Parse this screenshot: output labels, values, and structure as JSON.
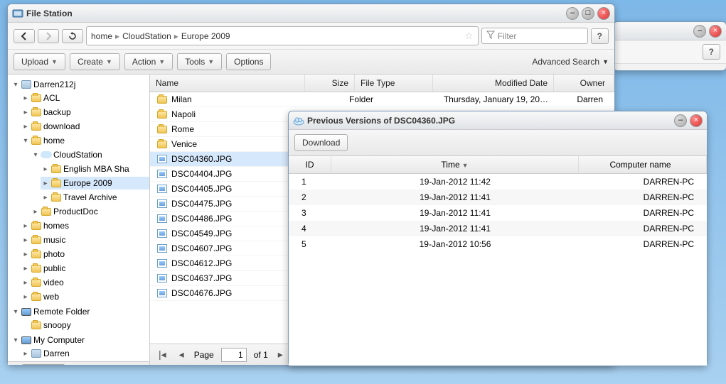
{
  "fs": {
    "title": "File Station",
    "path": [
      "home",
      "CloudStation",
      "Europe 2009"
    ],
    "filter_placeholder": "Filter",
    "toolbar": {
      "upload": "Upload",
      "create": "Create",
      "action": "Action",
      "tools": "Tools",
      "options": "Options",
      "adv_search": "Advanced Search"
    },
    "columns": {
      "name": "Name",
      "size": "Size",
      "type": "File Type",
      "modified": "Modified Date",
      "owner": "Owner"
    },
    "tree": {
      "root1": "Darren212j",
      "nodes": [
        {
          "label": "ACL",
          "icon": "folder",
          "depth": 1
        },
        {
          "label": "backup",
          "icon": "folder",
          "depth": 1
        },
        {
          "label": "download",
          "icon": "folder",
          "depth": 1
        },
        {
          "label": "home",
          "icon": "folder",
          "depth": 1,
          "open": true
        },
        {
          "label": "CloudStation",
          "icon": "cloud",
          "depth": 2,
          "open": true
        },
        {
          "label": "English MBA Sha",
          "icon": "folder",
          "depth": 3
        },
        {
          "label": "Europe 2009",
          "icon": "folder",
          "depth": 3,
          "sel": true
        },
        {
          "label": "Travel Archive",
          "icon": "folder",
          "depth": 3
        },
        {
          "label": "ProductDoc",
          "icon": "folder",
          "depth": 2
        },
        {
          "label": "homes",
          "icon": "folder",
          "depth": 1
        },
        {
          "label": "music",
          "icon": "folder",
          "depth": 1
        },
        {
          "label": "photo",
          "icon": "folder",
          "depth": 1
        },
        {
          "label": "public",
          "icon": "folder",
          "depth": 1
        },
        {
          "label": "video",
          "icon": "folder",
          "depth": 1
        },
        {
          "label": "web",
          "icon": "folder",
          "depth": 1
        }
      ],
      "root2": "Remote Folder",
      "remote_child": "snoopy",
      "root3": "My Computer",
      "comp_child": "Darren"
    },
    "rows": [
      {
        "name": "Milan",
        "icon": "folder",
        "type": "Folder",
        "modified": "Thursday, January 19, 20…",
        "owner": "Darren"
      },
      {
        "name": "Napoli",
        "icon": "folder"
      },
      {
        "name": "Rome",
        "icon": "folder"
      },
      {
        "name": "Venice",
        "icon": "folder"
      },
      {
        "name": "DSC04360.JPG",
        "icon": "jpg",
        "sel": true
      },
      {
        "name": "DSC04404.JPG",
        "icon": "jpg"
      },
      {
        "name": "DSC04405.JPG",
        "icon": "jpg"
      },
      {
        "name": "DSC04475.JPG",
        "icon": "jpg"
      },
      {
        "name": "DSC04486.JPG",
        "icon": "jpg"
      },
      {
        "name": "DSC04549.JPG",
        "icon": "jpg"
      },
      {
        "name": "DSC04607.JPG",
        "icon": "jpg"
      },
      {
        "name": "DSC04612.JPG",
        "icon": "jpg"
      },
      {
        "name": "DSC04637.JPG",
        "icon": "jpg"
      },
      {
        "name": "DSC04676.JPG",
        "icon": "jpg"
      }
    ],
    "pager": {
      "page_label": "Page",
      "page": "1",
      "of": "of 1"
    }
  },
  "pv": {
    "title": "Previous Versions of DSC04360.JPG",
    "download": "Download",
    "columns": {
      "id": "ID",
      "time": "Time",
      "comp": "Computer name"
    },
    "rows": [
      {
        "id": "1",
        "time": "19-Jan-2012 11:42",
        "comp": "DARREN-PC"
      },
      {
        "id": "2",
        "time": "19-Jan-2012 11:41",
        "comp": "DARREN-PC"
      },
      {
        "id": "3",
        "time": "19-Jan-2012 11:41",
        "comp": "DARREN-PC"
      },
      {
        "id": "4",
        "time": "19-Jan-2012 11:41",
        "comp": "DARREN-PC"
      },
      {
        "id": "5",
        "time": "19-Jan-2012 10:56",
        "comp": "DARREN-PC"
      }
    ]
  }
}
